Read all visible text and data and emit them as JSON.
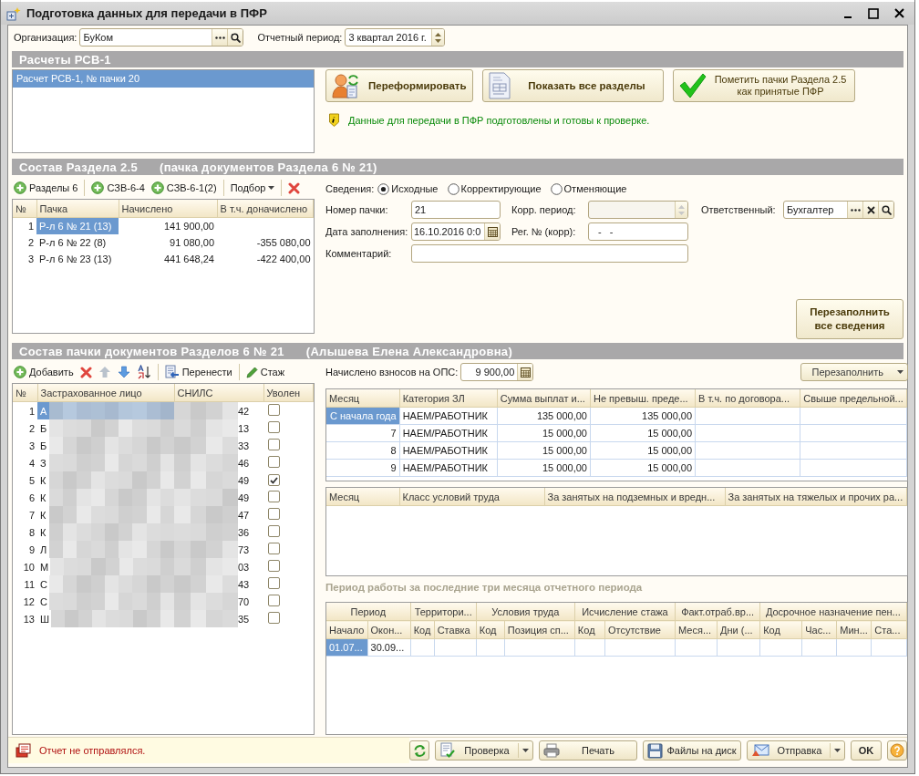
{
  "window": {
    "title": "Подготовка данных для передачи в ПФР"
  },
  "organization": {
    "label": "Организация:",
    "value": "БуКом"
  },
  "period": {
    "label": "Отчетный период:",
    "value": "3 квартал 2016 г."
  },
  "rsv": {
    "header": "Расчеты РСВ-1",
    "items": [
      {
        "text": "Расчет РСВ-1, № пачки 20",
        "selected": true
      }
    ],
    "buttons": [
      {
        "kind": "regenerate",
        "label": "Переформировать"
      },
      {
        "kind": "show_all",
        "label": "Показать все разделы"
      },
      {
        "kind": "mark_accepted",
        "label": "Пометить пачки Раздела 2.5 как принятые ПФР"
      }
    ],
    "info": "Данные для передачи в ПФР подготовлены и готовы к проверке."
  },
  "section25": {
    "header": "Состав Раздела 2.5",
    "header_note": "(пачка документов Раздела 6 № 21)",
    "toolbar": [
      {
        "kind": "add",
        "label": "Разделы 6",
        "separator_before": false
      },
      {
        "kind": "add",
        "label": "СЗВ-6-4",
        "separator_before": true
      },
      {
        "kind": "add",
        "label": "СЗВ-6-1(2)",
        "separator_before": false
      },
      {
        "kind": "menu",
        "label": "Подбор",
        "separator_before": true
      },
      {
        "kind": "delete",
        "separator_before": true
      }
    ],
    "columns": [
      "№",
      "Пачка",
      "Начислено",
      "В т.ч. доначислено"
    ],
    "rows": [
      {
        "n": "1",
        "pack": "Р-л 6 № 21 (13)",
        "accrued": "141 900,00",
        "selected": true
      },
      {
        "n": "2",
        "pack": "Р-л 6 № 22 (8)",
        "accrued": "91 080,00",
        "extra": "-355 080,00",
        "selected": false
      },
      {
        "n": "3",
        "pack": "Р-л 6 № 23 (13)",
        "accrued": "441 648,24",
        "extra": "-422 400,00",
        "selected": false
      }
    ]
  },
  "details": {
    "label": "Сведения:",
    "options": [
      {
        "label": "Исходные",
        "selected": true
      },
      {
        "label": "Корректирующие",
        "selected": false
      },
      {
        "label": "Отменяющие",
        "selected": false
      }
    ],
    "pack_number": {
      "label": "Номер пачки:",
      "value": "21"
    },
    "corr_period": {
      "label": "Корр. период:",
      "disabled": true
    },
    "responsible": {
      "label": "Ответственный:",
      "value": "Бухгалтер"
    },
    "fill_date": {
      "label": "Дата заполнения:",
      "value": "16.10.2016  0:0"
    },
    "reg_number": {
      "label": "Рег. № (корр):",
      "value": "-   -"
    },
    "comment": {
      "label": "Комментарий:"
    },
    "refill_all": "Перезаполнить все сведения"
  },
  "pack": {
    "header": "Состав пачки документов Разделов 6 № 21",
    "header_note": "(Алышева Елена Александровна)",
    "toolbar": [
      {
        "kind": "add",
        "label": "Добавить",
        "separator_before": false
      },
      {
        "kind": "delete",
        "separator_before": false
      },
      {
        "kind": "up",
        "separator_before": false
      },
      {
        "kind": "down",
        "separator_before": false
      },
      {
        "kind": "sort",
        "separator_before": false
      },
      {
        "kind": "transfer",
        "label": "Перенести",
        "separator_before": true
      },
      {
        "kind": "pencil",
        "label": "Стаж",
        "separator_before": true
      }
    ],
    "columns": [
      "№",
      "Застрахованное лицо",
      "СНИЛС",
      "Уволен"
    ],
    "rows": [
      {
        "n": "1",
        "name": "А",
        "snils": "42",
        "dismissed": false,
        "selected": true
      },
      {
        "n": "2",
        "name": "Б",
        "snils": "13",
        "dismissed": false,
        "selected": false
      },
      {
        "n": "3",
        "name": "Б",
        "snils": "33",
        "dismissed": false,
        "selected": false
      },
      {
        "n": "4",
        "name": "З",
        "snils": "46",
        "dismissed": false,
        "selected": false
      },
      {
        "n": "5",
        "name": "К",
        "snils": "49",
        "dismissed": true,
        "selected": false
      },
      {
        "n": "6",
        "name": "К",
        "snils": "49",
        "dismissed": false,
        "selected": false
      },
      {
        "n": "7",
        "name": "К",
        "snils": "47",
        "dismissed": false,
        "selected": false
      },
      {
        "n": "8",
        "name": "К",
        "snils": "36",
        "dismissed": false,
        "selected": false
      },
      {
        "n": "9",
        "name": "Л",
        "snils": "73",
        "dismissed": false,
        "selected": false
      },
      {
        "n": "10",
        "name": "М",
        "snils": "03",
        "dismissed": false,
        "selected": false
      },
      {
        "n": "11",
        "name": "С",
        "snils": "43",
        "dismissed": false,
        "selected": false
      },
      {
        "n": "12",
        "name": "С",
        "snils": "70",
        "dismissed": false,
        "selected": false
      },
      {
        "n": "13",
        "name": "Ш",
        "snils": "35",
        "dismissed": false,
        "selected": false
      }
    ]
  },
  "ops": {
    "label": "Начислено взносов на ОПС:",
    "value": "9 900,00",
    "refill": "Перезаполнить"
  },
  "payments": {
    "columns": [
      "Месяц",
      "Категория ЗЛ",
      "Сумма выплат и...",
      "Не превыш. преде...",
      "В т.ч. по договора...",
      "Свыше предельной..."
    ],
    "rows": [
      {
        "cells": [
          "С начала года",
          "НАЕМ/РАБОТНИК",
          "135 000,00",
          "135 000,00"
        ],
        "selected": true
      },
      {
        "cells": [
          "7",
          "НАЕМ/РАБОТНИК",
          "15 000,00",
          "15 000,00"
        ],
        "selected": false
      },
      {
        "cells": [
          "8",
          "НАЕМ/РАБОТНИК",
          "15 000,00",
          "15 000,00"
        ],
        "selected": false
      },
      {
        "cells": [
          "9",
          "НАЕМ/РАБОТНИК",
          "15 000,00",
          "15 000,00"
        ],
        "selected": false
      }
    ]
  },
  "conditions": {
    "columns": [
      "Месяц",
      "Класс условий труда",
      "За занятых на подземных и вредн...",
      "За занятых на тяжелых и прочих ра..."
    ]
  },
  "work_period": {
    "caption": "Период работы за последние три месяца отчетного периода",
    "groups": [
      "Период",
      "Территори...",
      "Условия труда",
      "Исчисление стажа",
      "Факт.отраб.вр...",
      "Досрочное назначение пен..."
    ],
    "columns": [
      "Начало",
      "Окон...",
      "Код",
      "Ставка",
      "Код",
      "Позиция сп...",
      "Код",
      "Отсутствие",
      "Меся...",
      "Дни (...",
      "Код",
      "Час...",
      "Мин...",
      "Ста..."
    ],
    "rows": [
      {
        "cells": [
          "01.07...",
          "30.09..."
        ],
        "selected": true
      }
    ]
  },
  "status": {
    "text": "Отчет не отправлялся.",
    "buttons": [
      {
        "kind": "refresh",
        "dropdown": false
      },
      {
        "kind": "check",
        "label": "Проверка",
        "dropdown": true
      },
      {
        "kind": "print",
        "label": "Печать",
        "dropdown": false
      },
      {
        "kind": "disk",
        "label": "Файлы на диск",
        "dropdown": false
      },
      {
        "kind": "send",
        "label": "Отправка",
        "dropdown": true
      },
      {
        "kind": "ok",
        "label": "OK",
        "dropdown": false
      },
      {
        "kind": "help",
        "dropdown": false
      }
    ]
  }
}
